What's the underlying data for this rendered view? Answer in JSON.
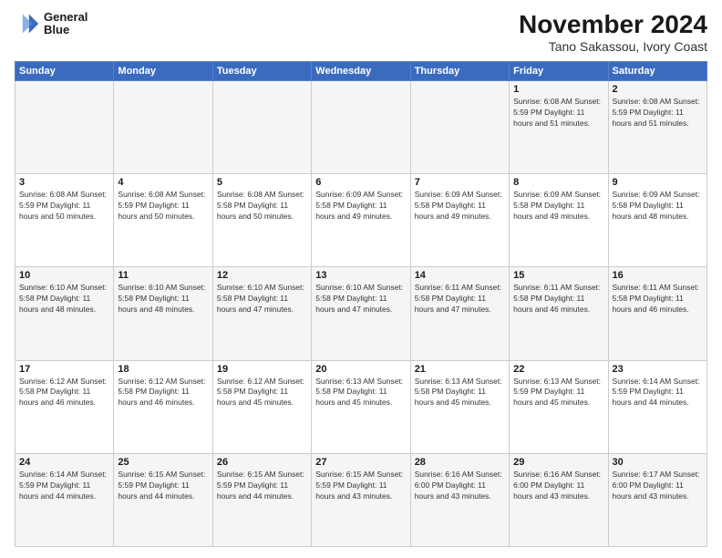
{
  "header": {
    "logo_line1": "General",
    "logo_line2": "Blue",
    "title": "November 2024",
    "subtitle": "Tano Sakassou, Ivory Coast"
  },
  "calendar": {
    "days_of_week": [
      "Sunday",
      "Monday",
      "Tuesday",
      "Wednesday",
      "Thursday",
      "Friday",
      "Saturday"
    ],
    "weeks": [
      [
        {
          "day": "",
          "info": ""
        },
        {
          "day": "",
          "info": ""
        },
        {
          "day": "",
          "info": ""
        },
        {
          "day": "",
          "info": ""
        },
        {
          "day": "",
          "info": ""
        },
        {
          "day": "1",
          "info": "Sunrise: 6:08 AM\nSunset: 5:59 PM\nDaylight: 11 hours and 51 minutes."
        },
        {
          "day": "2",
          "info": "Sunrise: 6:08 AM\nSunset: 5:59 PM\nDaylight: 11 hours and 51 minutes."
        }
      ],
      [
        {
          "day": "3",
          "info": "Sunrise: 6:08 AM\nSunset: 5:59 PM\nDaylight: 11 hours and 50 minutes."
        },
        {
          "day": "4",
          "info": "Sunrise: 6:08 AM\nSunset: 5:59 PM\nDaylight: 11 hours and 50 minutes."
        },
        {
          "day": "5",
          "info": "Sunrise: 6:08 AM\nSunset: 5:58 PM\nDaylight: 11 hours and 50 minutes."
        },
        {
          "day": "6",
          "info": "Sunrise: 6:09 AM\nSunset: 5:58 PM\nDaylight: 11 hours and 49 minutes."
        },
        {
          "day": "7",
          "info": "Sunrise: 6:09 AM\nSunset: 5:58 PM\nDaylight: 11 hours and 49 minutes."
        },
        {
          "day": "8",
          "info": "Sunrise: 6:09 AM\nSunset: 5:58 PM\nDaylight: 11 hours and 49 minutes."
        },
        {
          "day": "9",
          "info": "Sunrise: 6:09 AM\nSunset: 5:58 PM\nDaylight: 11 hours and 48 minutes."
        }
      ],
      [
        {
          "day": "10",
          "info": "Sunrise: 6:10 AM\nSunset: 5:58 PM\nDaylight: 11 hours and 48 minutes."
        },
        {
          "day": "11",
          "info": "Sunrise: 6:10 AM\nSunset: 5:58 PM\nDaylight: 11 hours and 48 minutes."
        },
        {
          "day": "12",
          "info": "Sunrise: 6:10 AM\nSunset: 5:58 PM\nDaylight: 11 hours and 47 minutes."
        },
        {
          "day": "13",
          "info": "Sunrise: 6:10 AM\nSunset: 5:58 PM\nDaylight: 11 hours and 47 minutes."
        },
        {
          "day": "14",
          "info": "Sunrise: 6:11 AM\nSunset: 5:58 PM\nDaylight: 11 hours and 47 minutes."
        },
        {
          "day": "15",
          "info": "Sunrise: 6:11 AM\nSunset: 5:58 PM\nDaylight: 11 hours and 46 minutes."
        },
        {
          "day": "16",
          "info": "Sunrise: 6:11 AM\nSunset: 5:58 PM\nDaylight: 11 hours and 46 minutes."
        }
      ],
      [
        {
          "day": "17",
          "info": "Sunrise: 6:12 AM\nSunset: 5:58 PM\nDaylight: 11 hours and 46 minutes."
        },
        {
          "day": "18",
          "info": "Sunrise: 6:12 AM\nSunset: 5:58 PM\nDaylight: 11 hours and 46 minutes."
        },
        {
          "day": "19",
          "info": "Sunrise: 6:12 AM\nSunset: 5:58 PM\nDaylight: 11 hours and 45 minutes."
        },
        {
          "day": "20",
          "info": "Sunrise: 6:13 AM\nSunset: 5:58 PM\nDaylight: 11 hours and 45 minutes."
        },
        {
          "day": "21",
          "info": "Sunrise: 6:13 AM\nSunset: 5:58 PM\nDaylight: 11 hours and 45 minutes."
        },
        {
          "day": "22",
          "info": "Sunrise: 6:13 AM\nSunset: 5:59 PM\nDaylight: 11 hours and 45 minutes."
        },
        {
          "day": "23",
          "info": "Sunrise: 6:14 AM\nSunset: 5:59 PM\nDaylight: 11 hours and 44 minutes."
        }
      ],
      [
        {
          "day": "24",
          "info": "Sunrise: 6:14 AM\nSunset: 5:59 PM\nDaylight: 11 hours and 44 minutes."
        },
        {
          "day": "25",
          "info": "Sunrise: 6:15 AM\nSunset: 5:59 PM\nDaylight: 11 hours and 44 minutes."
        },
        {
          "day": "26",
          "info": "Sunrise: 6:15 AM\nSunset: 5:59 PM\nDaylight: 11 hours and 44 minutes."
        },
        {
          "day": "27",
          "info": "Sunrise: 6:15 AM\nSunset: 5:59 PM\nDaylight: 11 hours and 43 minutes."
        },
        {
          "day": "28",
          "info": "Sunrise: 6:16 AM\nSunset: 6:00 PM\nDaylight: 11 hours and 43 minutes."
        },
        {
          "day": "29",
          "info": "Sunrise: 6:16 AM\nSunset: 6:00 PM\nDaylight: 11 hours and 43 minutes."
        },
        {
          "day": "30",
          "info": "Sunrise: 6:17 AM\nSunset: 6:00 PM\nDaylight: 11 hours and 43 minutes."
        }
      ]
    ]
  }
}
